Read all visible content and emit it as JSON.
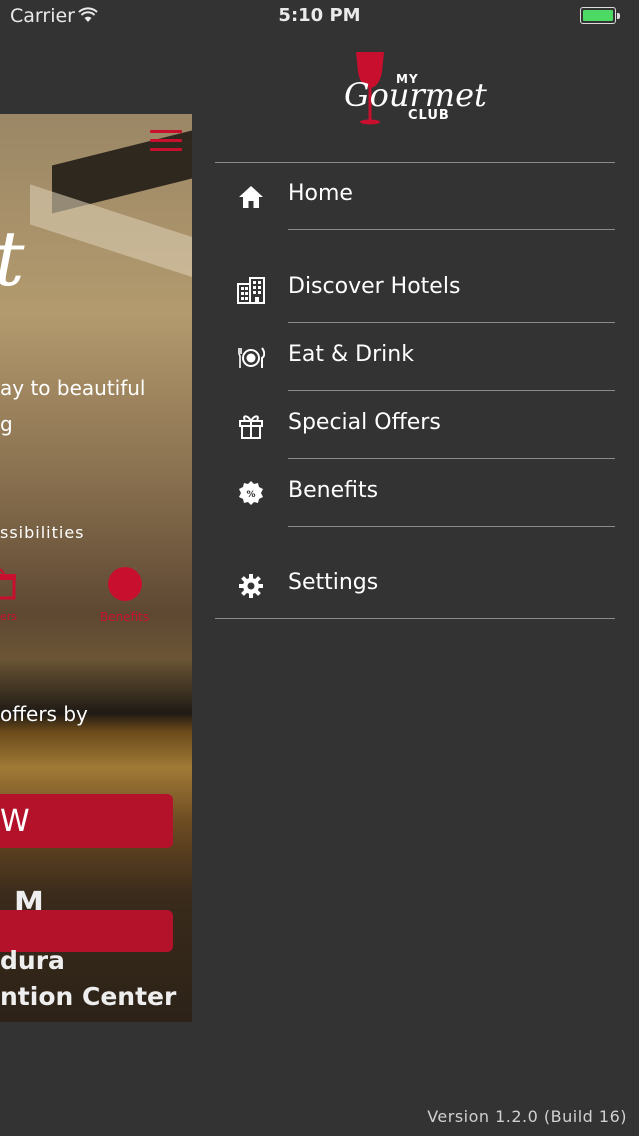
{
  "status_bar": {
    "carrier": "Carrier",
    "time": "5:10 PM"
  },
  "logo": {
    "my": "MY",
    "gourmet": "Gourmet",
    "club": "CLUB"
  },
  "background_screen": {
    "script_glyph": "t",
    "tagline": "ay to beautiful\ng",
    "possibilities": "ssibilities",
    "mini_label_1": "ers",
    "mini_label_2": "Benefits",
    "offers": "offers by",
    "button_letter": "W",
    "m_letter": "M",
    "venue_line1": "dura",
    "venue_line2": "ntion Center"
  },
  "menu": {
    "items": [
      {
        "label": "Home",
        "icon": "home-icon"
      },
      {
        "label": "Discover Hotels",
        "icon": "hotel-building-icon"
      },
      {
        "label": "Eat & Drink",
        "icon": "plate-cutlery-icon"
      },
      {
        "label": "Special Offers",
        "icon": "gift-icon"
      },
      {
        "label": "Benefits",
        "icon": "percent-badge-icon"
      },
      {
        "label": "Settings",
        "icon": "gear-icon"
      }
    ]
  },
  "version": "Version 1.2.0 (Build 16)",
  "colors": {
    "background": "#333333",
    "accent": "#c8102e",
    "divider": "#8a8a8a"
  }
}
